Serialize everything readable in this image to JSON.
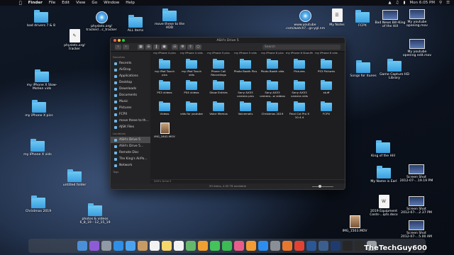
{
  "menubar": {
    "items": [
      "Finder",
      "File",
      "Edit",
      "View",
      "Go",
      "Window",
      "Help"
    ],
    "clock": "Mon 6:05 PM"
  },
  "desktop": {
    "bad_drivers": "bad drivers 7 & 8",
    "physlets_tracker1": "physlets.org/\ntracker/...c_tracker",
    "physlets_tracker2": "physlets.org/\ntracker",
    "all_items": "ALL items",
    "move_hdd": "move these to the\nHDD",
    "yt_watch": "www.youtube\n.com/watch?...gs-ygl.nm",
    "my_notes": "My Notes",
    "fcpx": "FCPX",
    "bad_news": "Bad News Bill-King\nof the Hill",
    "yt_opening_mov": "My youtube\nopening.mov",
    "yt_opening_edit": "My youtube\nopening edit.mov",
    "songs_itunes": "Songs for itunes",
    "game_capture": "Game Capture HD\nLibrary",
    "iphonex_slow": "my iPhone X Slow-\nMotion vids",
    "iphonex_pics": "my iPhone X pics",
    "iphonex_vids": "my iPhone X vids",
    "untitled": "untitled folder",
    "christmas": "Christmas 2019",
    "photos_videos": "photos & videos\n6_8_19 - 12_15_19",
    "king_hill": "King of the Hill",
    "my_name": "My Name is Earl",
    "equipment": "2019 Equipment\nCosts-...ipts.docx",
    "img_1503": "IMG_1503.MOV",
    "shot1": "Screen Shot\n2012-07-...19.19 PM",
    "shot2": "Screen Shot\n2012-07-...2.37 PM",
    "shot3": "Screen Shot\n2012-07-...5.00 AM"
  },
  "finder": {
    "title": "ASH's Drive 5",
    "search_placeholder": "Search",
    "sidebar": {
      "favorites_header": "Favorites",
      "favorites": [
        "Recents",
        "AirDrop",
        "Applications",
        "Desktop",
        "Downloads",
        "Documents",
        "Music",
        "Pictures",
        "FCPX",
        "move these to th...",
        "AJSK Files"
      ],
      "locations_header": "Locations",
      "locations": [
        "ASH's Drive 5",
        "ASH's Drive 5...",
        "Remote Disc",
        "The King's AirPo...",
        "Network"
      ],
      "tags_header": "Tags"
    },
    "columns": [
      "my iPhone 4 pics",
      "my iPhone 4 vids",
      "my iPhone 5 pics",
      "my iPhone 5 vids",
      "my iPhone 6 pics",
      "my iPhone 6 Slow-Motion vids",
      "my iPhone 6 vids"
    ],
    "items": [
      "my iPod Touch\npics",
      "my iPod Touch\nvids",
      "Phone Call\nRecordings",
      "Photo Booth Pics",
      "Photo Booth vids",
      "Pictures",
      "PS3 Pictures",
      "PS3 videos",
      "PS4 videos",
      "Show Entries",
      "Sony AX53\ncamera pics",
      "Sony AX53\ncamera...w videos",
      "Sony AX53\ncamera vids",
      "stuff",
      "Videos",
      "vids for youtube",
      "Voice Memos",
      "Voicemails",
      "Christmas 2019",
      "Final Cut Pro X\n10.4.4",
      "FCPX",
      "IMG_1642.MOV"
    ],
    "path": "ASH's Drive 5",
    "status": "93 items, 4.55 TB available"
  },
  "dock": [
    "Finder",
    "Siri",
    "Launchpad",
    "Safari",
    "Mail",
    "Contacts",
    "Calendar",
    "Notes",
    "Reminders",
    "Maps",
    "Photos",
    "Messages",
    "FaceTime",
    "iTunes",
    "Books",
    "App Store",
    "System Preferences",
    "Firefox",
    "Chrome",
    "Word",
    "Lightroom",
    "Photoshop",
    "Final Cut",
    "Terminal",
    "Trash"
  ],
  "watermark": "TheTechGuy600",
  "colors": {
    "folder": "#4fb2ee",
    "accent": "#3a9fe0",
    "window_bg": "#1e1e20"
  }
}
